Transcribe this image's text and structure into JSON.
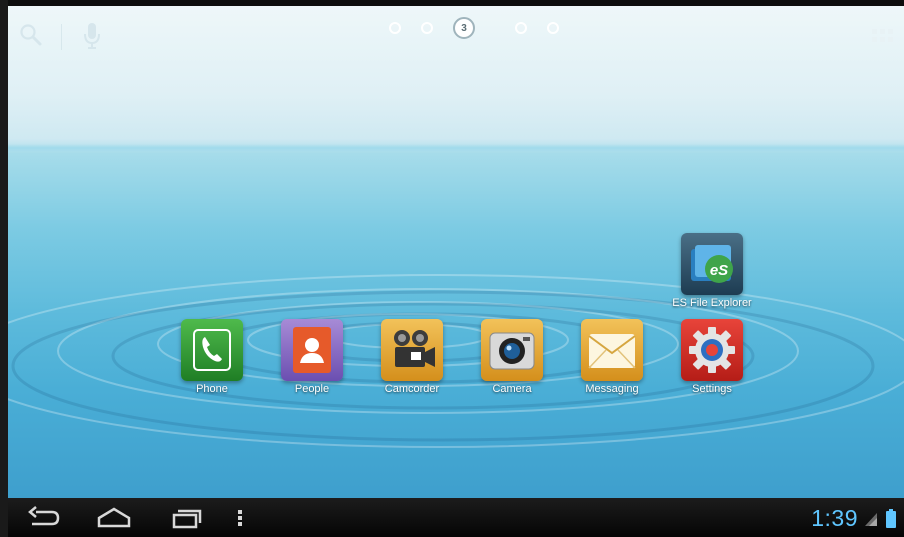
{
  "home": {
    "page_indicator": {
      "pages": 5,
      "current": "3"
    },
    "apps": [
      {
        "id": "phone",
        "label": "Phone"
      },
      {
        "id": "people",
        "label": "People"
      },
      {
        "id": "camcorder",
        "label": "Camcorder"
      },
      {
        "id": "camera",
        "label": "Camera"
      },
      {
        "id": "messaging",
        "label": "Messaging"
      },
      {
        "id": "settings",
        "label": "Settings"
      }
    ],
    "shortcut": {
      "label": "ES File Explorer"
    }
  },
  "statusbar": {
    "time": "1:39",
    "clock_color": "#5fc6ff"
  },
  "icons": {
    "search": "search-icon",
    "voice": "mic-icon",
    "all_apps": "apps-grid-icon",
    "back": "back-icon",
    "home": "home-icon",
    "recents": "recents-icon",
    "menu": "menu-icon",
    "signal": "signal-icon",
    "battery": "battery-icon"
  }
}
